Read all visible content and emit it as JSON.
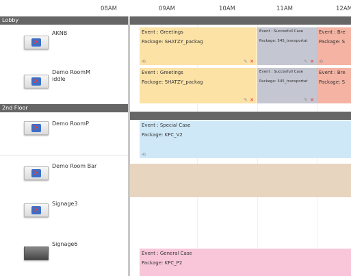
{
  "timeline": {
    "times": [
      "08AM",
      "09AM",
      "10AM",
      "11AM",
      "12AM"
    ]
  },
  "groups": [
    {
      "name": "Lobby"
    },
    {
      "name": "2nd Floor"
    }
  ],
  "rooms": [
    {
      "name": "AKNB"
    },
    {
      "name": "Demo RoomM iddle"
    },
    {
      "name": "Demo RoomP"
    },
    {
      "name": "Demo Room Bar"
    },
    {
      "name": "Signage3"
    },
    {
      "name": "Signage6"
    }
  ],
  "events": [
    {
      "event": "Event : Greetings",
      "package": "Package: SHATZY_packag"
    },
    {
      "event": "Event : Succesfull Case",
      "package": "Package: 545_transportat"
    },
    {
      "event": "Event : Bre",
      "package": "Package: S"
    },
    {
      "event": "Event : Greetings",
      "package": "Package: SHATZY_packag"
    },
    {
      "event": "Event : Succesfull Case",
      "package": "Package: 545_transportat"
    },
    {
      "event": "Event : Bre",
      "package": "Package: S"
    },
    {
      "event": "Event : Special Case",
      "package": "Package: KFC_V2"
    },
    {
      "event": "Event : General Case",
      "package": "Package: KFC_P2"
    }
  ],
  "icons": {
    "edit": "pencil-icon",
    "delete": "close-icon",
    "repeat": "repeat-icon"
  },
  "colors": {
    "group_header": "#666666",
    "event_yellow": "#fde2a6",
    "event_gray": "#c4c6d1",
    "event_salmon": "#f4b3a3",
    "event_blue": "#cfe8f7",
    "event_tan": "#e8d5c0",
    "event_pink": "#f8c6d8"
  }
}
